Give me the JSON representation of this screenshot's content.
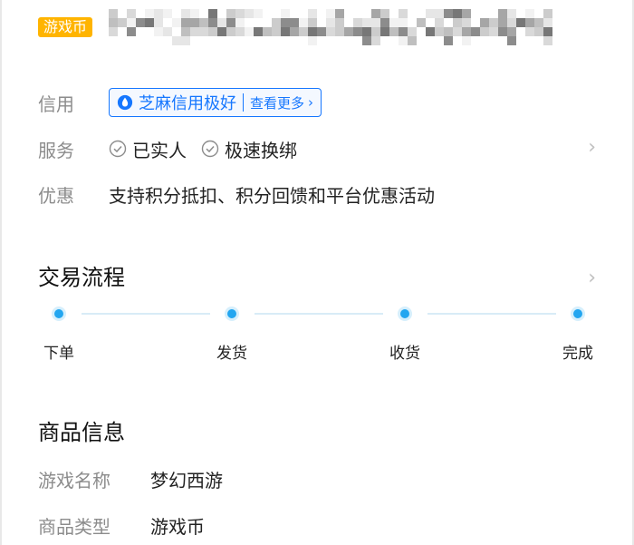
{
  "header": {
    "category_tag": "游戏币"
  },
  "info": {
    "credit": {
      "label": "信用",
      "badge_text": "芝麻信用极好",
      "more_text": "查看更多"
    },
    "service": {
      "label": "服务",
      "items": [
        "已实人",
        "极速换绑"
      ]
    },
    "discount": {
      "label": "优惠",
      "text": "支持积分抵扣、积分回馈和平台优惠活动"
    }
  },
  "trade_process": {
    "title": "交易流程",
    "steps": [
      "下单",
      "发货",
      "收货",
      "完成"
    ]
  },
  "product_info": {
    "title": "商品信息",
    "rows": [
      {
        "label": "游戏名称",
        "value": "梦幻西游"
      },
      {
        "label": "商品类型",
        "value": "游戏币"
      }
    ]
  },
  "colors": {
    "tag_orange": "#ffb400",
    "credit_blue": "#1677ff",
    "timeline_dot": "#23a6f0"
  }
}
